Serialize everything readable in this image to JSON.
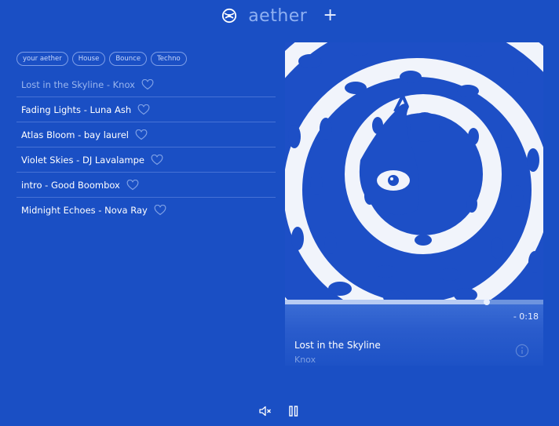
{
  "header": {
    "title": "aether",
    "add_label": "+"
  },
  "tags": [
    "your aether",
    "House",
    "Bounce",
    "Techno"
  ],
  "tracks": [
    {
      "label": "Lost in the Skyline - Knox",
      "active": true
    },
    {
      "label": "Fading Lights - Luna Ash",
      "active": false
    },
    {
      "label": "Atlas Bloom - bay laurel",
      "active": false
    },
    {
      "label": "Violet Skies - DJ Lavalampe",
      "active": false
    },
    {
      "label": "intro - Good Boombox",
      "active": false
    },
    {
      "label": "Midnight Echoes - Nova Ray",
      "active": false
    }
  ],
  "now_playing": {
    "title": "Lost in the Skyline",
    "artist": "Knox",
    "time_remaining": "- 0:18",
    "progress": 0.78
  },
  "colors": {
    "background": "#1a4fc4",
    "accent_muted": "#8fb0f2",
    "artwork_light": "#ffffff",
    "artwork_blue": "#1d4fc6"
  },
  "icons": {
    "logo": "aether-logo-icon",
    "heart": "heart-outline-icon",
    "info": "info-icon",
    "mute": "volume-mute-icon",
    "pause": "pause-icon"
  }
}
